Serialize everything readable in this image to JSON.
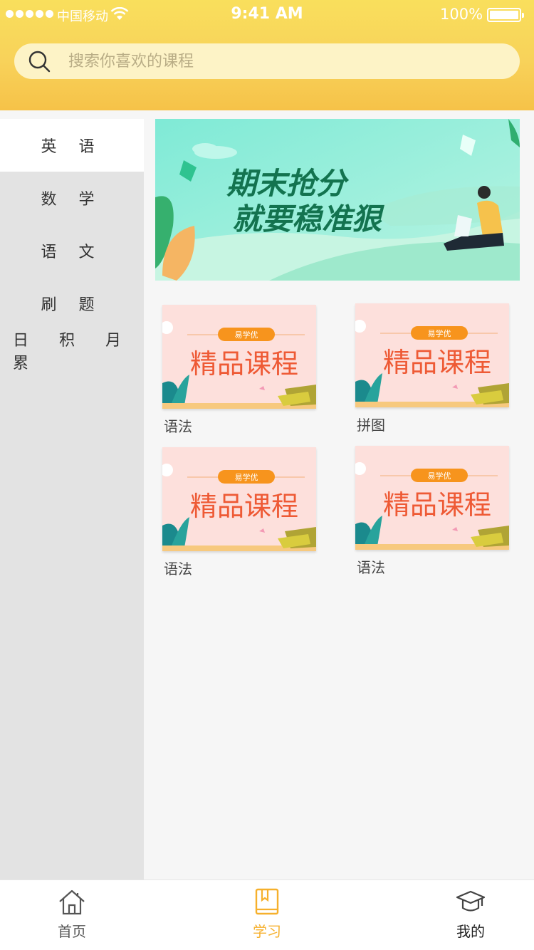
{
  "status_bar": {
    "carrier": "中国移动",
    "time": "9:41 AM",
    "battery": "100%"
  },
  "search": {
    "placeholder": "搜索你喜欢的课程"
  },
  "sidebar": {
    "items": [
      {
        "label": "英 语",
        "active": true
      },
      {
        "label": "数 学",
        "active": false
      },
      {
        "label": "语 文",
        "active": false
      },
      {
        "label": "刷 题",
        "active": false
      },
      {
        "label": "日 积 月 累",
        "active": false
      }
    ]
  },
  "banner": {
    "line1": "期末抢分",
    "line2": "就要稳准狠"
  },
  "courses": [
    {
      "badge": "易学优",
      "title": "精品课程",
      "name": "语法"
    },
    {
      "badge": "易学优",
      "title": "精品课程",
      "name": "拼图"
    },
    {
      "badge": "易学优",
      "title": "精品课程",
      "name": "语法"
    },
    {
      "badge": "易学优",
      "title": "精品课程",
      "name": "语法"
    }
  ],
  "tabbar": {
    "items": [
      {
        "label": "首页",
        "icon": "home-icon",
        "active": false
      },
      {
        "label": "学习",
        "icon": "book-icon",
        "active": true
      },
      {
        "label": "我的",
        "icon": "graduation-cap-icon",
        "active": false
      }
    ]
  },
  "colors": {
    "header_top": "#f9df5c",
    "header_bottom": "#f6c248",
    "accent": "#f6b02c",
    "course_title": "#ee5a35"
  }
}
